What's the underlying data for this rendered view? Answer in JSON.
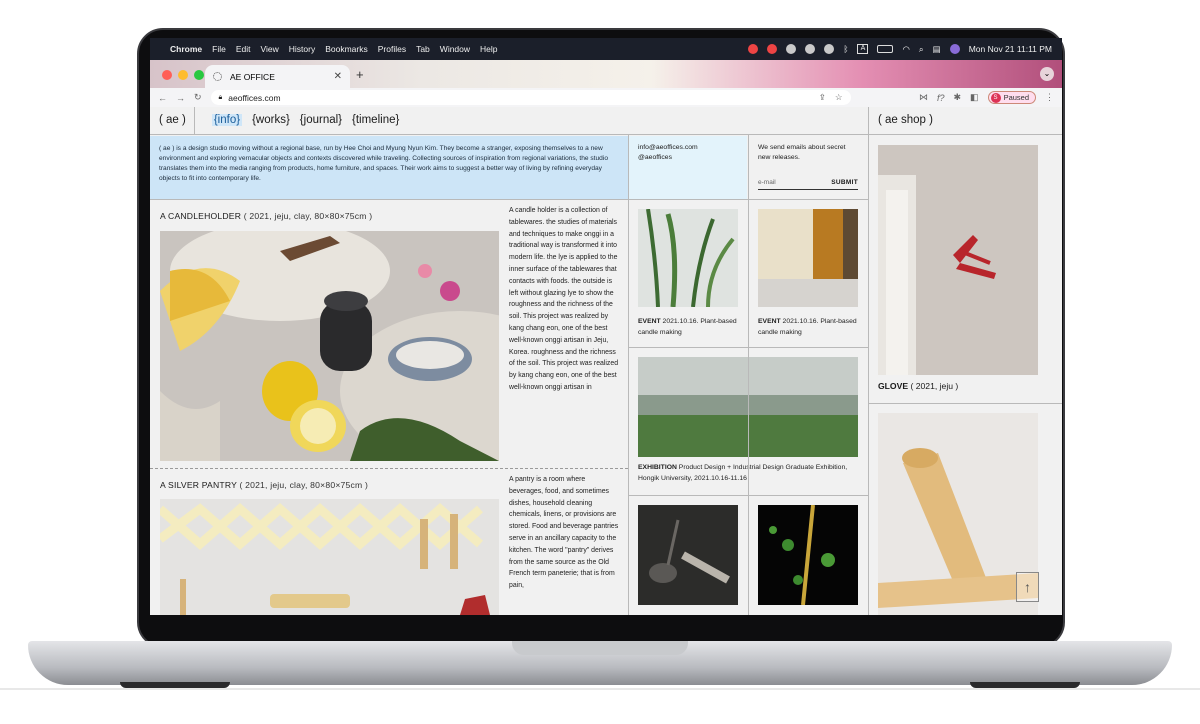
{
  "menubar": {
    "apple": "",
    "items": [
      "Chrome",
      "File",
      "Edit",
      "View",
      "History",
      "Bookmarks",
      "Profiles",
      "Tab",
      "Window",
      "Help"
    ],
    "clock": "Mon Nov 21  11:11 PM",
    "input_badge": "A"
  },
  "browser": {
    "tab_title": "AE OFFICE",
    "tab_close": "✕",
    "new_tab": "+",
    "url": "aeoffices.com",
    "profile_initial": "S",
    "profile_status": "Paused",
    "ext_label": "f?",
    "colors": {
      "close": "#ff5f57",
      "minimize": "#febc2e",
      "maximize": "#28c840"
    }
  },
  "site": {
    "nav": {
      "home": "( ae )",
      "info": "{info}",
      "works": "{works}",
      "journal": "{journal}",
      "timeline": "{timeline}",
      "shop": "( ae shop )"
    },
    "about": "( ae ) is a design studio moving without a regional base, run by Hee Choi and Myung Nyun Kim. They become a stranger, exposing themselves to a new environment and exploring vernacular objects and contexts discovered while traveling. Collecting sources of inspiration from regional variations, the studio translates them into the media ranging from products, home furniture, and spaces. Their work aims to suggest a better way of living by refining everyday objects to fit into contemporary life.",
    "contact": {
      "email": "info@aeoffices.com",
      "instagram": "@aeoffices"
    },
    "newsletter": {
      "text": "We send emails about secret new releases.",
      "placeholder": "e-mail",
      "submit": "SUBMIT"
    },
    "works": [
      {
        "title": "A CANDLEHOLDER",
        "meta": "( 2021, jeju, clay, 80×80×75cm )",
        "desc": "A candle holder is a collection of tablewares. the studies of materials and techniques to make onggi in a traditional way is transformed it into modern life. the lye is applied to the inner surface of the tablewares that contacts with foods. the outside is left without glazing lye to show the roughness and the richness of the soil. This project was realized by kang chang eon, one of the best well-known onggi artisan in Jeju, Korea. roughness and the richness of the soil. This project was realized by kang chang eon, one of the best well-known onggi artisan in"
      },
      {
        "title": "A SILVER PANTRY",
        "meta": "( 2021, jeju, clay, 80×80×75cm )",
        "desc": "A pantry is a room where beverages, food, and sometimes dishes, household cleaning chemicals, linens, or provisions are stored. Food and beverage pantries serve in an ancillary capacity to the kitchen. The word \"pantry\" derives from the same source as the Old French term paneterie; that is from pain,"
      }
    ],
    "journal": [
      {
        "label": "EVENT",
        "text": " 2021.10.16. Plant-based candle making"
      },
      {
        "label": "EVENT",
        "text": " 2021.10.16. Plant-based candle making"
      },
      {
        "label": "EXHIBITION",
        "text": " Product Design + Industrial Design Graduate Exhibition, Hongik University, 2021.10.16-11.16"
      }
    ],
    "shop": [
      {
        "title": "GLOVE",
        "meta": "( 2021, jeju )"
      }
    ],
    "to_top": "↑"
  }
}
